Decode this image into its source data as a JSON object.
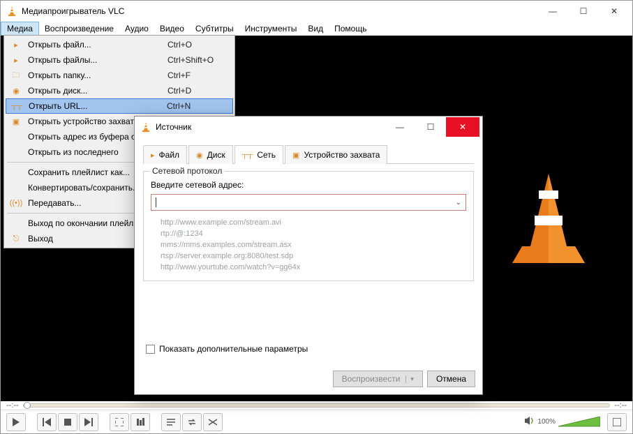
{
  "app": {
    "title": "Медиапроигрыватель VLC"
  },
  "menubar": [
    "Медиа",
    "Воспроизведение",
    "Аудио",
    "Видео",
    "Субтитры",
    "Инструменты",
    "Вид",
    "Помощь"
  ],
  "dropdown": {
    "items": [
      {
        "icon": "file",
        "label": "Открыть файл...",
        "shortcut": "Ctrl+O"
      },
      {
        "icon": "files",
        "label": "Открыть файлы...",
        "shortcut": "Ctrl+Shift+O"
      },
      {
        "icon": "folder",
        "label": "Открыть папку...",
        "shortcut": "Ctrl+F"
      },
      {
        "icon": "disc",
        "label": "Открыть диск...",
        "shortcut": "Ctrl+D"
      },
      {
        "icon": "net",
        "label": "Открыть URL...",
        "shortcut": "Ctrl+N",
        "highlight": true
      },
      {
        "icon": "capture",
        "label": "Открыть устройство захвата...",
        "shortcut": ""
      },
      {
        "icon": "",
        "label": "Открыть адрес из буфера обмена",
        "shortcut": ""
      },
      {
        "icon": "",
        "label": "Открыть из последнего",
        "shortcut": "",
        "arrow": true
      },
      {
        "sep": true
      },
      {
        "icon": "",
        "label": "Сохранить плейлист как...",
        "shortcut": ""
      },
      {
        "icon": "",
        "label": "Конвертировать/сохранить...",
        "shortcut": ""
      },
      {
        "icon": "stream",
        "label": "Передавать...",
        "shortcut": ""
      },
      {
        "sep": true
      },
      {
        "icon": "",
        "label": "Выход по окончании плейлиста",
        "shortcut": ""
      },
      {
        "icon": "exit",
        "label": "Выход",
        "shortcut": ""
      }
    ]
  },
  "dialog": {
    "title": "Источник",
    "tabs": [
      {
        "icon": "file",
        "label": "Файл"
      },
      {
        "icon": "disc",
        "label": "Диск"
      },
      {
        "icon": "net",
        "label": "Сеть",
        "active": true
      },
      {
        "icon": "capture",
        "label": "Устройство захвата"
      }
    ],
    "group_title": "Сетевой протокол",
    "field_label": "Введите сетевой адрес:",
    "url_value": "",
    "examples": [
      "http://www.example.com/stream.avi",
      "rtp://@:1234",
      "mms://mms.examples.com/stream.asx",
      "rtsp://server.example.org:8080/test.sdp",
      "http://www.yourtube.com/watch?v=gg64x"
    ],
    "show_more": "Показать дополнительные параметры",
    "play_btn": "Воспроизвести",
    "cancel_btn": "Отмена"
  },
  "seek": {
    "left": "--:--",
    "right": "--:--"
  },
  "volume": {
    "label": "100%"
  }
}
